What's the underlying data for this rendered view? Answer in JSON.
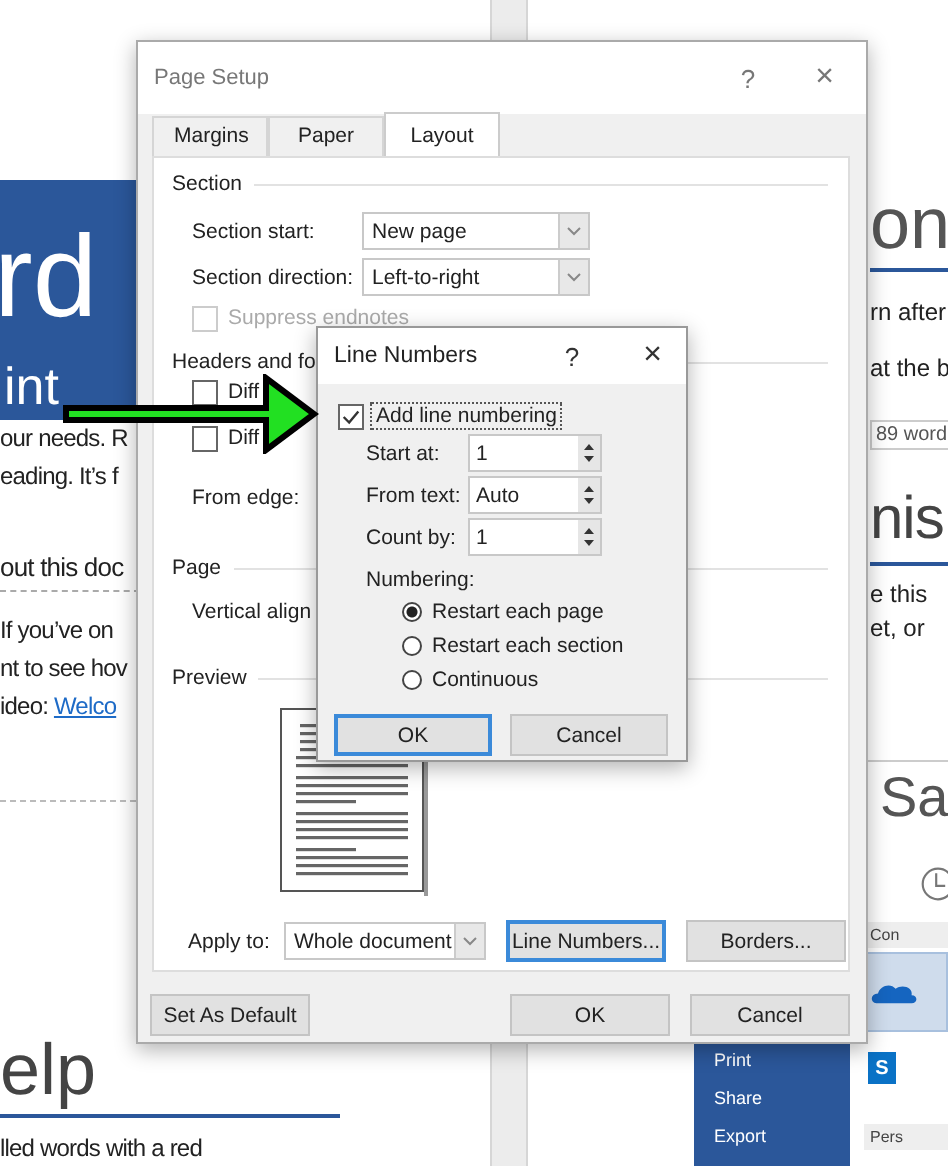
{
  "left_page": {
    "banner_title": "rd",
    "banner_subtitle": "int",
    "lines": [
      {
        "kind": "text",
        "text": "our needs. R"
      },
      {
        "kind": "text",
        "text": "eading. It’s f"
      },
      {
        "kind": "heading",
        "text": "out this doc"
      },
      {
        "kind": "text",
        "text": "If you’ve on"
      },
      {
        "kind": "text",
        "text": "nt to see hov"
      },
      {
        "kind": "link",
        "text": "ideo: ",
        "link": "Welco"
      }
    ],
    "heading": "elp",
    "last_line": "lled words with a red"
  },
  "right_page": {
    "heading": "on",
    "lines": [
      {
        "kind": "text",
        "text": "rn after"
      },
      {
        "kind": "text",
        "text": "at the b"
      },
      {
        "kind": "count",
        "text": "89 word"
      }
    ],
    "heading2": "nis",
    "lines2": [
      "e this",
      "et, or"
    ]
  },
  "backstage": {
    "nav": [
      "Print",
      "Share",
      "Export"
    ],
    "title": "Sa",
    "sections": [
      {
        "label": "Con"
      },
      {
        "label": "Pers"
      }
    ],
    "sharepoint_letter": "S"
  },
  "page_setup": {
    "title": "Page Setup",
    "help": "?",
    "close": "×",
    "tabs": [
      {
        "label": "Margins",
        "selected": false
      },
      {
        "label": "Paper",
        "selected": false
      },
      {
        "label": "Layout",
        "selected": true
      }
    ],
    "section": {
      "label": "Section",
      "fields": [
        {
          "label": "Section start:",
          "value": "New page"
        },
        {
          "label": "Section direction:",
          "value": "Left-to-right"
        }
      ],
      "suppress_endnotes": {
        "label": "Suppress endnotes",
        "checked": false,
        "disabled": true
      }
    },
    "headers_footers": {
      "label": "Headers and fo",
      "checkboxes": [
        {
          "label": "Diff",
          "checked": false
        },
        {
          "label": "Diff",
          "checked": false
        }
      ],
      "from_edge": "From edge:"
    },
    "page": {
      "label": "Page",
      "vertical_alignment": "Vertical align"
    },
    "preview": {
      "label": "Preview"
    },
    "apply_to": {
      "label": "Apply to:",
      "value": "Whole document"
    },
    "buttons": [
      {
        "label": "Line Numbers...",
        "focused": true
      },
      {
        "label": "Borders...",
        "focused": false
      }
    ],
    "set_default": "Set As Default",
    "footer_buttons": [
      {
        "label": "OK",
        "focused": false
      },
      {
        "label": "Cancel",
        "focused": false
      }
    ]
  },
  "line_numbers": {
    "title": "Line Numbers",
    "help": "?",
    "close": "×",
    "add_numbering": {
      "label": "Add line numbering",
      "checked": true
    },
    "fields": [
      {
        "label": "Start at:",
        "value": "1"
      },
      {
        "label": "From text:",
        "value": "Auto"
      },
      {
        "label": "Count by:",
        "value": "1"
      }
    ],
    "numbering_label": "Numbering:",
    "options": [
      {
        "label": "Restart each page",
        "selected": true
      },
      {
        "label": "Restart each section",
        "selected": false
      },
      {
        "label": "Continuous",
        "selected": false
      }
    ],
    "buttons": [
      {
        "label": "OK",
        "focused": true
      },
      {
        "label": "Cancel",
        "focused": false
      }
    ]
  }
}
